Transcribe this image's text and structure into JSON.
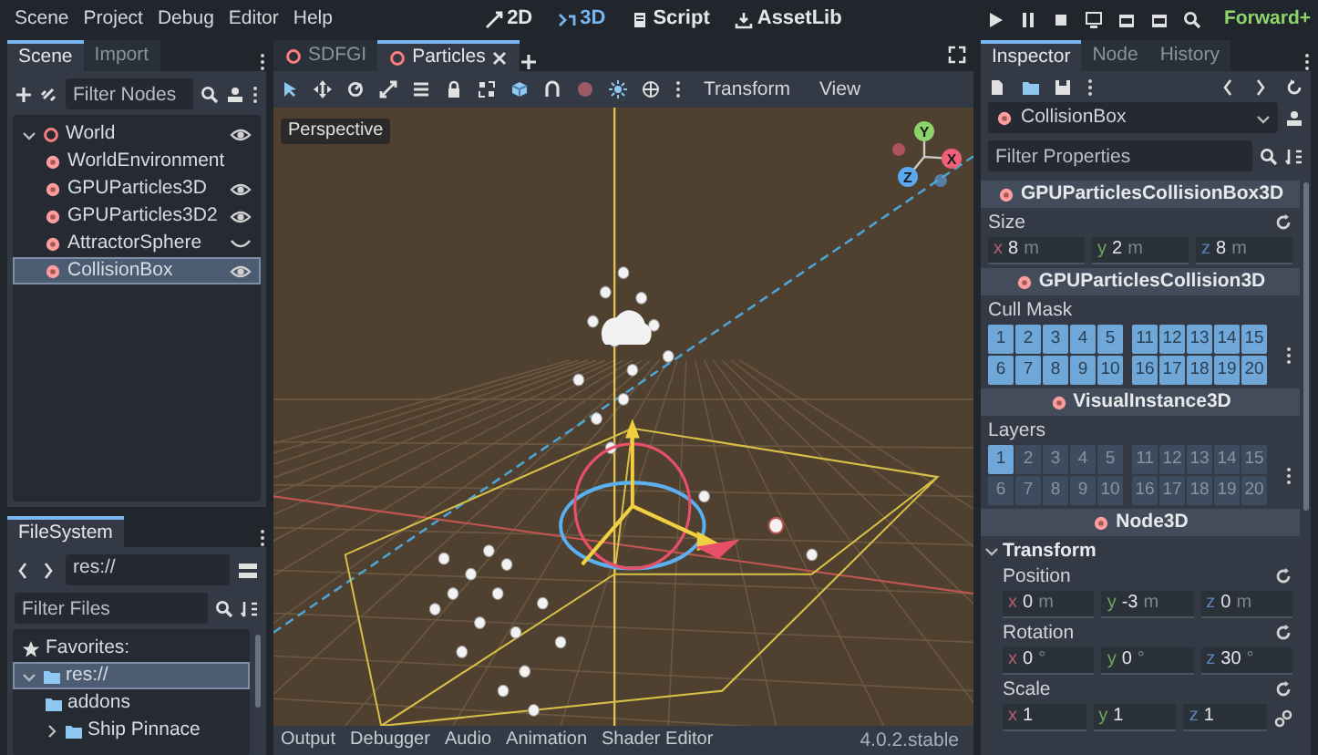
{
  "menu": [
    "Scene",
    "Project",
    "Debug",
    "Editor",
    "Help"
  ],
  "workspaces": [
    {
      "label": "2D",
      "selected": false
    },
    {
      "label": "3D",
      "selected": true
    },
    {
      "label": "Script",
      "selected": false
    },
    {
      "label": "AssetLib",
      "selected": false
    }
  ],
  "renderer": "Forward+",
  "scene_dock": {
    "tabs": [
      {
        "label": "Scene",
        "selected": true
      },
      {
        "label": "Import",
        "selected": false
      }
    ],
    "filter": {
      "placeholder": "Filter Nodes"
    },
    "tree": [
      {
        "label": "World",
        "selected": false,
        "visible": true,
        "expanded": true,
        "children": [
          {
            "label": "WorldEnvironment",
            "selected": false
          },
          {
            "label": "GPUParticles3D",
            "selected": false,
            "visible": true
          },
          {
            "label": "GPUParticles3D2",
            "selected": false,
            "visible": true
          },
          {
            "label": "AttractorSphere",
            "selected": false,
            "visible": false
          },
          {
            "label": "CollisionBox",
            "selected": true,
            "visible": true
          }
        ]
      }
    ]
  },
  "filesystem_dock": {
    "tabs": [
      {
        "label": "FileSystem",
        "selected": true
      }
    ],
    "path": "res://",
    "filter": {
      "placeholder": "Filter Files"
    },
    "tree": [
      {
        "kind": "favorites",
        "label": "Favorites:",
        "selected": false
      },
      {
        "kind": "folder",
        "label": "res://",
        "selected": true,
        "expanded": true,
        "children": [
          {
            "kind": "folder",
            "label": "addons",
            "selected": false
          },
          {
            "kind": "folder",
            "label": "Ship Pinnace",
            "selected": false,
            "expanded": false
          }
        ]
      }
    ]
  },
  "viewport": {
    "tabs": [
      {
        "label": "SDFGI",
        "selected": false
      },
      {
        "label": "Particles",
        "selected": true
      }
    ],
    "menus": [
      "Transform",
      "View"
    ],
    "view_label": "Perspective",
    "gizmo_axes": [
      "Y",
      "X",
      "Z"
    ]
  },
  "bottom_panel": {
    "tabs": [
      "Output",
      "Debugger",
      "Audio",
      "Animation",
      "Shader Editor"
    ],
    "version": "4.0.2.stable"
  },
  "inspector": {
    "tabs": [
      {
        "label": "Inspector",
        "selected": true
      },
      {
        "label": "Node",
        "selected": false
      },
      {
        "label": "History",
        "selected": false
      }
    ],
    "node": "CollisionBox",
    "filter": {
      "placeholder": "Filter Properties"
    },
    "properties": [
      {
        "kind": "section",
        "title": "GPUParticlesCollisionBox3D"
      },
      {
        "kind": "vector",
        "label": "Size",
        "modified": true,
        "components": [
          {
            "axis": "x",
            "value": "8",
            "unit": "m"
          },
          {
            "axis": "y",
            "value": "2",
            "unit": "m"
          },
          {
            "axis": "z",
            "value": "8",
            "unit": "m"
          }
        ]
      },
      {
        "kind": "section",
        "title": "GPUParticlesCollision3D"
      },
      {
        "kind": "layers",
        "label": "Cull Mask",
        "cells": [
          {
            "label": "1",
            "selected": true
          },
          {
            "label": "2",
            "selected": true
          },
          {
            "label": "3",
            "selected": true
          },
          {
            "label": "4",
            "selected": true
          },
          {
            "label": "5",
            "selected": true
          },
          {
            "label": "11",
            "selected": true
          },
          {
            "label": "12",
            "selected": true
          },
          {
            "label": "13",
            "selected": true
          },
          {
            "label": "14",
            "selected": true
          },
          {
            "label": "15",
            "selected": true
          },
          {
            "label": "6",
            "selected": true
          },
          {
            "label": "7",
            "selected": true
          },
          {
            "label": "8",
            "selected": true
          },
          {
            "label": "9",
            "selected": true
          },
          {
            "label": "10",
            "selected": true
          },
          {
            "label": "16",
            "selected": true
          },
          {
            "label": "17",
            "selected": true
          },
          {
            "label": "18",
            "selected": true
          },
          {
            "label": "19",
            "selected": true
          },
          {
            "label": "20",
            "selected": true
          }
        ]
      },
      {
        "kind": "section",
        "title": "VisualInstance3D"
      },
      {
        "kind": "layers",
        "label": "Layers",
        "cells": [
          {
            "label": "1",
            "selected": true
          },
          {
            "label": "2",
            "selected": false
          },
          {
            "label": "3",
            "selected": false
          },
          {
            "label": "4",
            "selected": false
          },
          {
            "label": "5",
            "selected": false
          },
          {
            "label": "11",
            "selected": false
          },
          {
            "label": "12",
            "selected": false
          },
          {
            "label": "13",
            "selected": false
          },
          {
            "label": "14",
            "selected": false
          },
          {
            "label": "15",
            "selected": false
          },
          {
            "label": "6",
            "selected": false
          },
          {
            "label": "7",
            "selected": false
          },
          {
            "label": "8",
            "selected": false
          },
          {
            "label": "9",
            "selected": false
          },
          {
            "label": "10",
            "selected": false
          },
          {
            "label": "16",
            "selected": false
          },
          {
            "label": "17",
            "selected": false
          },
          {
            "label": "18",
            "selected": false
          },
          {
            "label": "19",
            "selected": false
          },
          {
            "label": "20",
            "selected": false
          }
        ]
      },
      {
        "kind": "section",
        "title": "Node3D"
      },
      {
        "kind": "group",
        "title": "Transform",
        "expanded": true,
        "children": [
          {
            "kind": "vector",
            "label": "Position",
            "modified": true,
            "components": [
              {
                "axis": "x",
                "value": "0",
                "unit": "m"
              },
              {
                "axis": "y",
                "value": "-3",
                "unit": "m"
              },
              {
                "axis": "z",
                "value": "0",
                "unit": "m"
              }
            ]
          },
          {
            "kind": "vector",
            "label": "Rotation",
            "modified": true,
            "components": [
              {
                "axis": "x",
                "value": "0",
                "unit": "°"
              },
              {
                "axis": "y",
                "value": "0",
                "unit": "°"
              },
              {
                "axis": "z",
                "value": "30",
                "unit": "°"
              }
            ]
          },
          {
            "kind": "vector",
            "label": "Scale",
            "modified": true,
            "linked": true,
            "components": [
              {
                "axis": "x",
                "value": "1"
              },
              {
                "axis": "y",
                "value": "1"
              },
              {
                "axis": "z",
                "value": "1"
              }
            ]
          }
        ]
      }
    ]
  }
}
